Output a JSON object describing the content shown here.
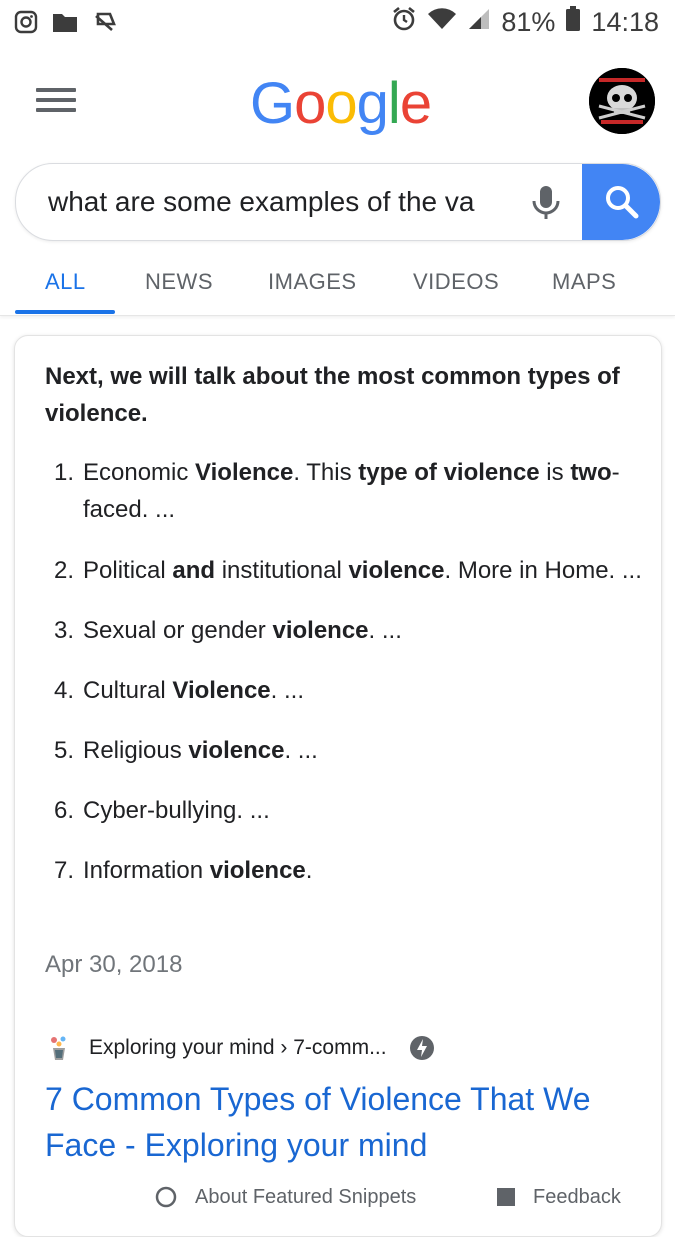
{
  "status_bar": {
    "battery": "81%",
    "time": "14:18",
    "icons_left": [
      "instagram-icon",
      "folder-icon",
      "notifications-off-icon"
    ],
    "icons_right": [
      "alarm-icon",
      "wifi-icon",
      "signal-icon",
      "battery-icon"
    ]
  },
  "header": {
    "logo": "Google",
    "logo_colors": [
      "#4285f4",
      "#ea4335",
      "#fbbc05",
      "#4285f4",
      "#34a853",
      "#ea4335"
    ]
  },
  "search": {
    "query": "what are some examples of the va"
  },
  "tabs": [
    {
      "label": "ALL",
      "active": true
    },
    {
      "label": "NEWS",
      "active": false
    },
    {
      "label": "IMAGES",
      "active": false
    },
    {
      "label": "VIDEOS",
      "active": false
    },
    {
      "label": "MAPS",
      "active": false
    }
  ],
  "snippet": {
    "heading": "Next, we will talk about the most common types of violence.",
    "items": [
      {
        "num": "1.",
        "parts": [
          [
            "Economic ",
            false
          ],
          [
            "Violence",
            true
          ],
          [
            ". This ",
            false
          ],
          [
            "type of violence",
            true
          ],
          [
            " is ",
            false
          ],
          [
            "two",
            true
          ],
          [
            "-faced. ...",
            false
          ]
        ]
      },
      {
        "num": "2.",
        "parts": [
          [
            "Political ",
            false
          ],
          [
            "and",
            true
          ],
          [
            " institutional ",
            false
          ],
          [
            "violence",
            true
          ],
          [
            ". More in Home. ...",
            false
          ]
        ]
      },
      {
        "num": "3.",
        "parts": [
          [
            "Sexual or gender ",
            false
          ],
          [
            "violence",
            true
          ],
          [
            ". ...",
            false
          ]
        ]
      },
      {
        "num": "4.",
        "parts": [
          [
            "Cultural ",
            false
          ],
          [
            "Violence",
            true
          ],
          [
            ". ...",
            false
          ]
        ]
      },
      {
        "num": "5.",
        "parts": [
          [
            "Religious ",
            false
          ],
          [
            "violence",
            true
          ],
          [
            ". ...",
            false
          ]
        ]
      },
      {
        "num": "6.",
        "parts": [
          [
            "Cyber-bullying. ...",
            false
          ]
        ]
      },
      {
        "num": "7.",
        "parts": [
          [
            "Information ",
            false
          ],
          [
            "violence",
            true
          ],
          [
            ".",
            false
          ]
        ]
      }
    ],
    "date": "Apr 30, 2018",
    "source": "Exploring your mind › 7-comm...",
    "title": "7 Common Types of Violence That We Face - Exploring your mind",
    "footer_left": "About Featured Snippets",
    "footer_right": "Feedback"
  },
  "colors": {
    "accent": "#1a73e8",
    "search_button": "#4285f4",
    "link": "#1967d2"
  }
}
